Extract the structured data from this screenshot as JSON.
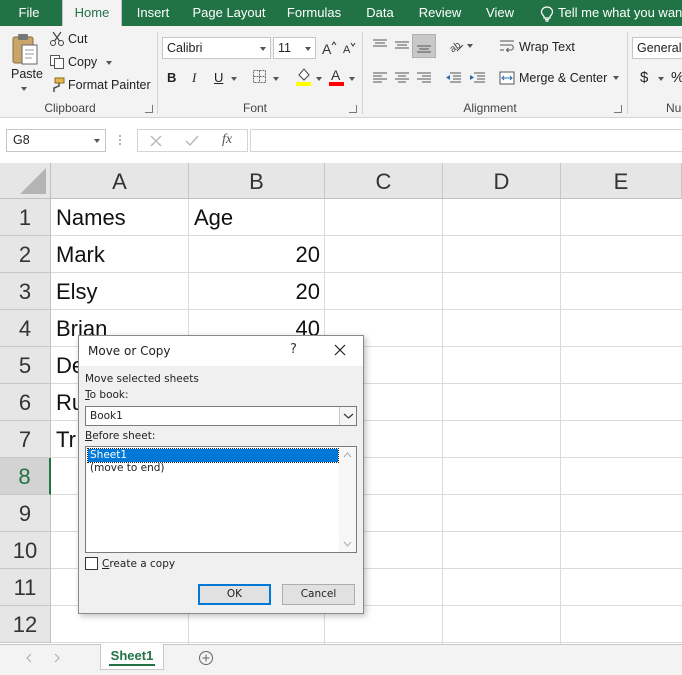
{
  "tabs": [
    {
      "label": "File"
    },
    {
      "label": "Home"
    },
    {
      "label": "Insert"
    },
    {
      "label": "Page Layout"
    },
    {
      "label": "Formulas"
    },
    {
      "label": "Data"
    },
    {
      "label": "Review"
    },
    {
      "label": "View"
    }
  ],
  "tell_me": "Tell me what you want t",
  "ribbon": {
    "clipboard": {
      "paste": "Paste",
      "cut": "Cut",
      "copy": "Copy",
      "format_painter": "Format Painter",
      "label": "Clipboard"
    },
    "font": {
      "name": "Calibri",
      "size": "11",
      "bold": "B",
      "italic": "I",
      "underline": "U",
      "label": "Font",
      "highlight_color": "#ffff00",
      "font_color": "#ff0000"
    },
    "alignment": {
      "wrap_text": "Wrap Text",
      "merge_center": "Merge & Center",
      "label": "Alignment"
    },
    "number": {
      "format": "General",
      "currency": "$",
      "percent": "%",
      "label": "Nu"
    }
  },
  "formula_bar": {
    "name_box": "G8",
    "fx": "fx",
    "formula": ""
  },
  "grid": {
    "columns": [
      "A",
      "B",
      "C",
      "D",
      "E"
    ],
    "rows": [
      "1",
      "2",
      "3",
      "4",
      "5",
      "6",
      "7",
      "8",
      "9",
      "10",
      "11",
      "12"
    ],
    "selected_row": "8",
    "cells": {
      "A1": "Names",
      "B1": "Age",
      "A2": "Mark",
      "B2": "20",
      "A3": "Elsy",
      "B3": "20",
      "A4": "Brian",
      "B4": "40",
      "A5": "De",
      "A6": "Ru",
      "A7": "Tr"
    }
  },
  "sheet_tabs": [
    {
      "label": "Sheet1"
    }
  ],
  "dialog": {
    "title": "Move or Copy",
    "help": "?",
    "move_selected_label": "Move selected sheets",
    "to_book_label_u": "T",
    "to_book_label_rest": "o book:",
    "to_book_value": "Book1",
    "before_sheet_label_u": "B",
    "before_sheet_label_rest": "efore sheet:",
    "before_sheet_items": [
      "Sheet1",
      "(move to end)"
    ],
    "create_copy_u": "C",
    "create_copy_rest": "reate a copy",
    "create_copy_checked": false,
    "ok": "OK",
    "cancel": "Cancel"
  },
  "colors": {
    "excel_green": "#217346",
    "selection_blue": "#0078d7"
  }
}
